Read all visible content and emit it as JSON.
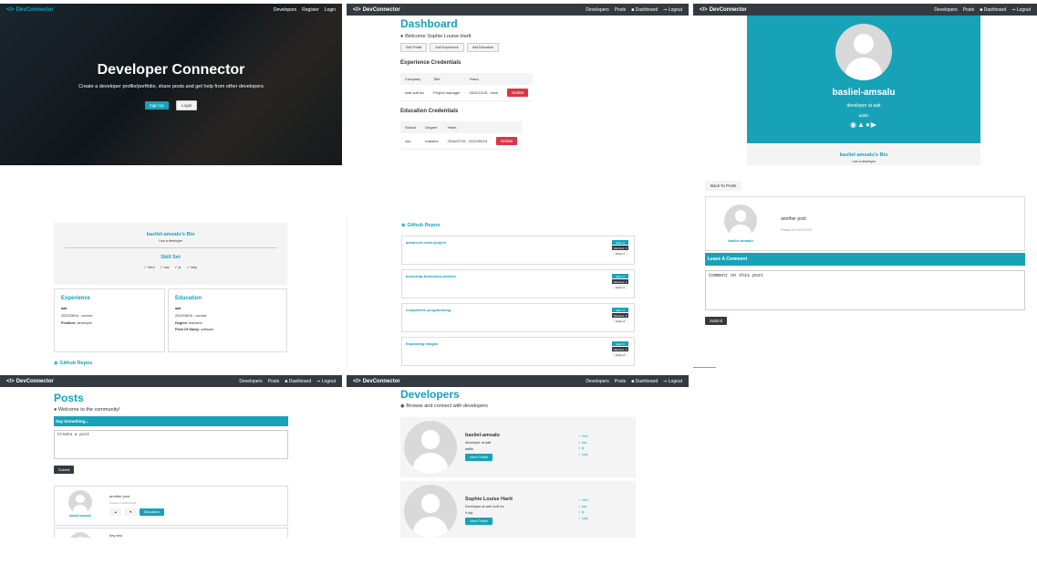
{
  "landing": {
    "brand": "DevConnector",
    "nav": [
      "Developers",
      "Register",
      "Login"
    ],
    "title": "Developer Connector",
    "lead": "Create a developer profile/portfolio, share posts and get help from other developers",
    "signup": "Sign Up",
    "login": "Login"
  },
  "dashboard": {
    "brand": "DevConnector",
    "nav": [
      "Developers",
      "Posts",
      "Dashboard",
      "Logout"
    ],
    "title": "Dashboard",
    "welcome": "Welcome Sophie Louise Hartt",
    "actions": [
      "Edit Profile",
      "Add Experience",
      "Add Education"
    ],
    "exp_heading": "Experience Credentials",
    "exp_headers": [
      "Company",
      "Title",
      "Years"
    ],
    "exp_row": [
      "web soft inc",
      "Project manager",
      "2022/12/15 - Now"
    ],
    "delete_label": "Delete",
    "edu_heading": "Education Credentials",
    "edu_headers": [
      "School",
      "Degree",
      "Years"
    ],
    "edu_row": [
      "nyu",
      "masters",
      "2016/07/15 - 2021/05/19"
    ]
  },
  "profile_top": {
    "brand": "DevConnector",
    "nav": [
      "Developers",
      "Posts",
      "Dashboard",
      "Logout"
    ],
    "name": "basliel-amsalu",
    "status": "developer at aait",
    "location": "addis",
    "bio_heading": "basliel-amsalu's Bio",
    "bio_text": "I am a developer"
  },
  "profile_detail": {
    "bio_heading": "basliel-amsalu's Bio",
    "bio_text": "I am a developer",
    "skill_heading": "Skill Set",
    "skills": [
      "html",
      "css",
      "js",
      "ruby"
    ],
    "exp_heading": "Experience",
    "exp_company": "aait",
    "exp_dates": "2022/08/16 - current",
    "exp_position_label": "Position:",
    "exp_position": "developer",
    "edu_heading": "Education",
    "edu_school": "aait",
    "edu_dates": "2022/08/16 - current",
    "edu_degree_label": "Degree:",
    "edu_degree": "bachelor",
    "edu_field_label": "Field Of Study:",
    "edu_field": "software",
    "repos_heading": "Github Repos"
  },
  "repos": {
    "heading": "Github Repos",
    "items": [
      "advanced-react-project",
      "bootstrap-bootcamp-website",
      "competitive-programming",
      "Expanding Images"
    ],
    "stars": "Stars: 0",
    "watchers": "Watchers: 0",
    "forks": "Forks: 0"
  },
  "post_single": {
    "back": "Back To Posts",
    "post_text": "another post",
    "post_date": "Posted on 2022/11/03",
    "author": "basliel-amsalu",
    "leave_comment": "Leave A Comment",
    "comment_placeholder": "Comment on this post",
    "submit": "Submit"
  },
  "posts": {
    "brand": "DevConnector",
    "nav": [
      "Developers",
      "Posts",
      "Dashboard",
      "Logout"
    ],
    "title": "Posts",
    "welcome": "Welcome to the community!",
    "say": "Say Something...",
    "create_placeholder": "Create a post",
    "submit": "Submit",
    "post_text": "another post",
    "post_date": "Posted on 2022/11/03",
    "author": "basliel-amsalu",
    "discussion": "Discussion",
    "second_post_text": "hey test"
  },
  "developers": {
    "brand": "DevConnector",
    "nav": [
      "Developers",
      "Posts",
      "Dashboard",
      "Logout"
    ],
    "title": "Developers",
    "subtitle": "Browse and connect with developers",
    "view_profile": "View Profile",
    "profiles": [
      {
        "name": "basliel-amsalu",
        "status": "developer at aait",
        "location": "addis",
        "skills": [
          "html",
          "css",
          "js",
          "ruby"
        ]
      },
      {
        "name": "Sophie Louise Hartt",
        "status": "Developer at web soft inc",
        "location": "il city",
        "skills": [
          "html",
          "css",
          "js",
          "ruby"
        ]
      }
    ]
  },
  "colors": {
    "primary": "#17a2b8",
    "dark": "#343a40",
    "light": "#f4f4f4",
    "danger": "#dc3545"
  }
}
